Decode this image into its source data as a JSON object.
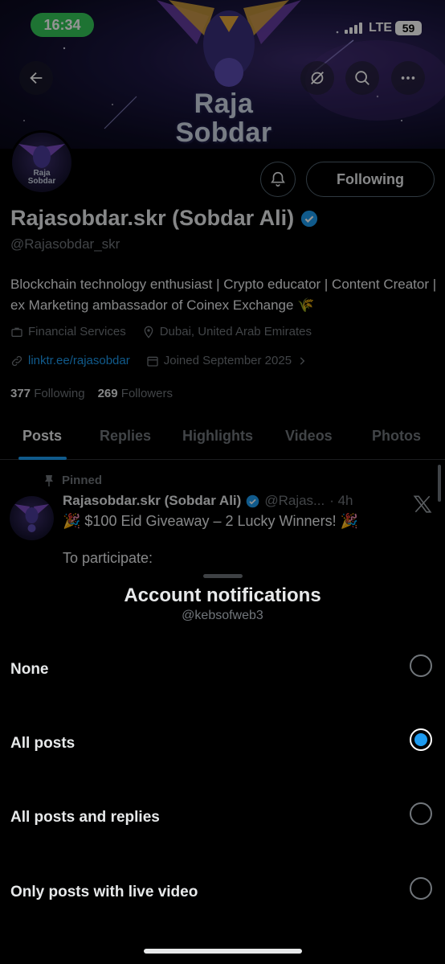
{
  "status_bar": {
    "time": "16:34",
    "network": "LTE",
    "battery": "59"
  },
  "banner": {
    "title_line1": "Raja",
    "title_line2": "Sobdar"
  },
  "avatar": {
    "line1": "Raja",
    "line2": "Sobdar"
  },
  "profile": {
    "following_button": "Following",
    "display_name": "Rajasobdar.skr (Sobdar Ali)",
    "handle": "@Rajasobdar_skr",
    "bio": "Blockchain technology enthusiast | Crypto educator | Content Creator | ex Marketing ambassador of Coinex Exchange 🌾",
    "category": "Financial Services",
    "location": "Dubai, United Arab Emirates",
    "link": "linktr.ee/rajasobdar",
    "joined": "Joined September 2025",
    "following_count": "377",
    "following_label": "Following",
    "followers_count": "269",
    "followers_label": "Followers"
  },
  "tabs": [
    "Posts",
    "Replies",
    "Highlights",
    "Videos",
    "Photos"
  ],
  "pinned_post": {
    "pinned_label": "Pinned",
    "author_name": "Rajasobdar.skr (Sobdar Ali)",
    "author_handle": "@Rajas...",
    "time": "· 4h",
    "line1": "🎉 $100 Eid Giveaway – 2 Lucky Winners! 🎉",
    "line2": "To participate:"
  },
  "sheet": {
    "title": "Account notifications",
    "subtitle": "@kebsofweb3",
    "options": [
      {
        "label": "None",
        "selected": false
      },
      {
        "label": "All posts",
        "selected": true
      },
      {
        "label": "All posts and replies",
        "selected": false
      },
      {
        "label": "Only posts with live video",
        "selected": false
      }
    ]
  },
  "colors": {
    "accent": "#1d9bf0",
    "status_green": "#34c759",
    "muted": "#71767b"
  }
}
